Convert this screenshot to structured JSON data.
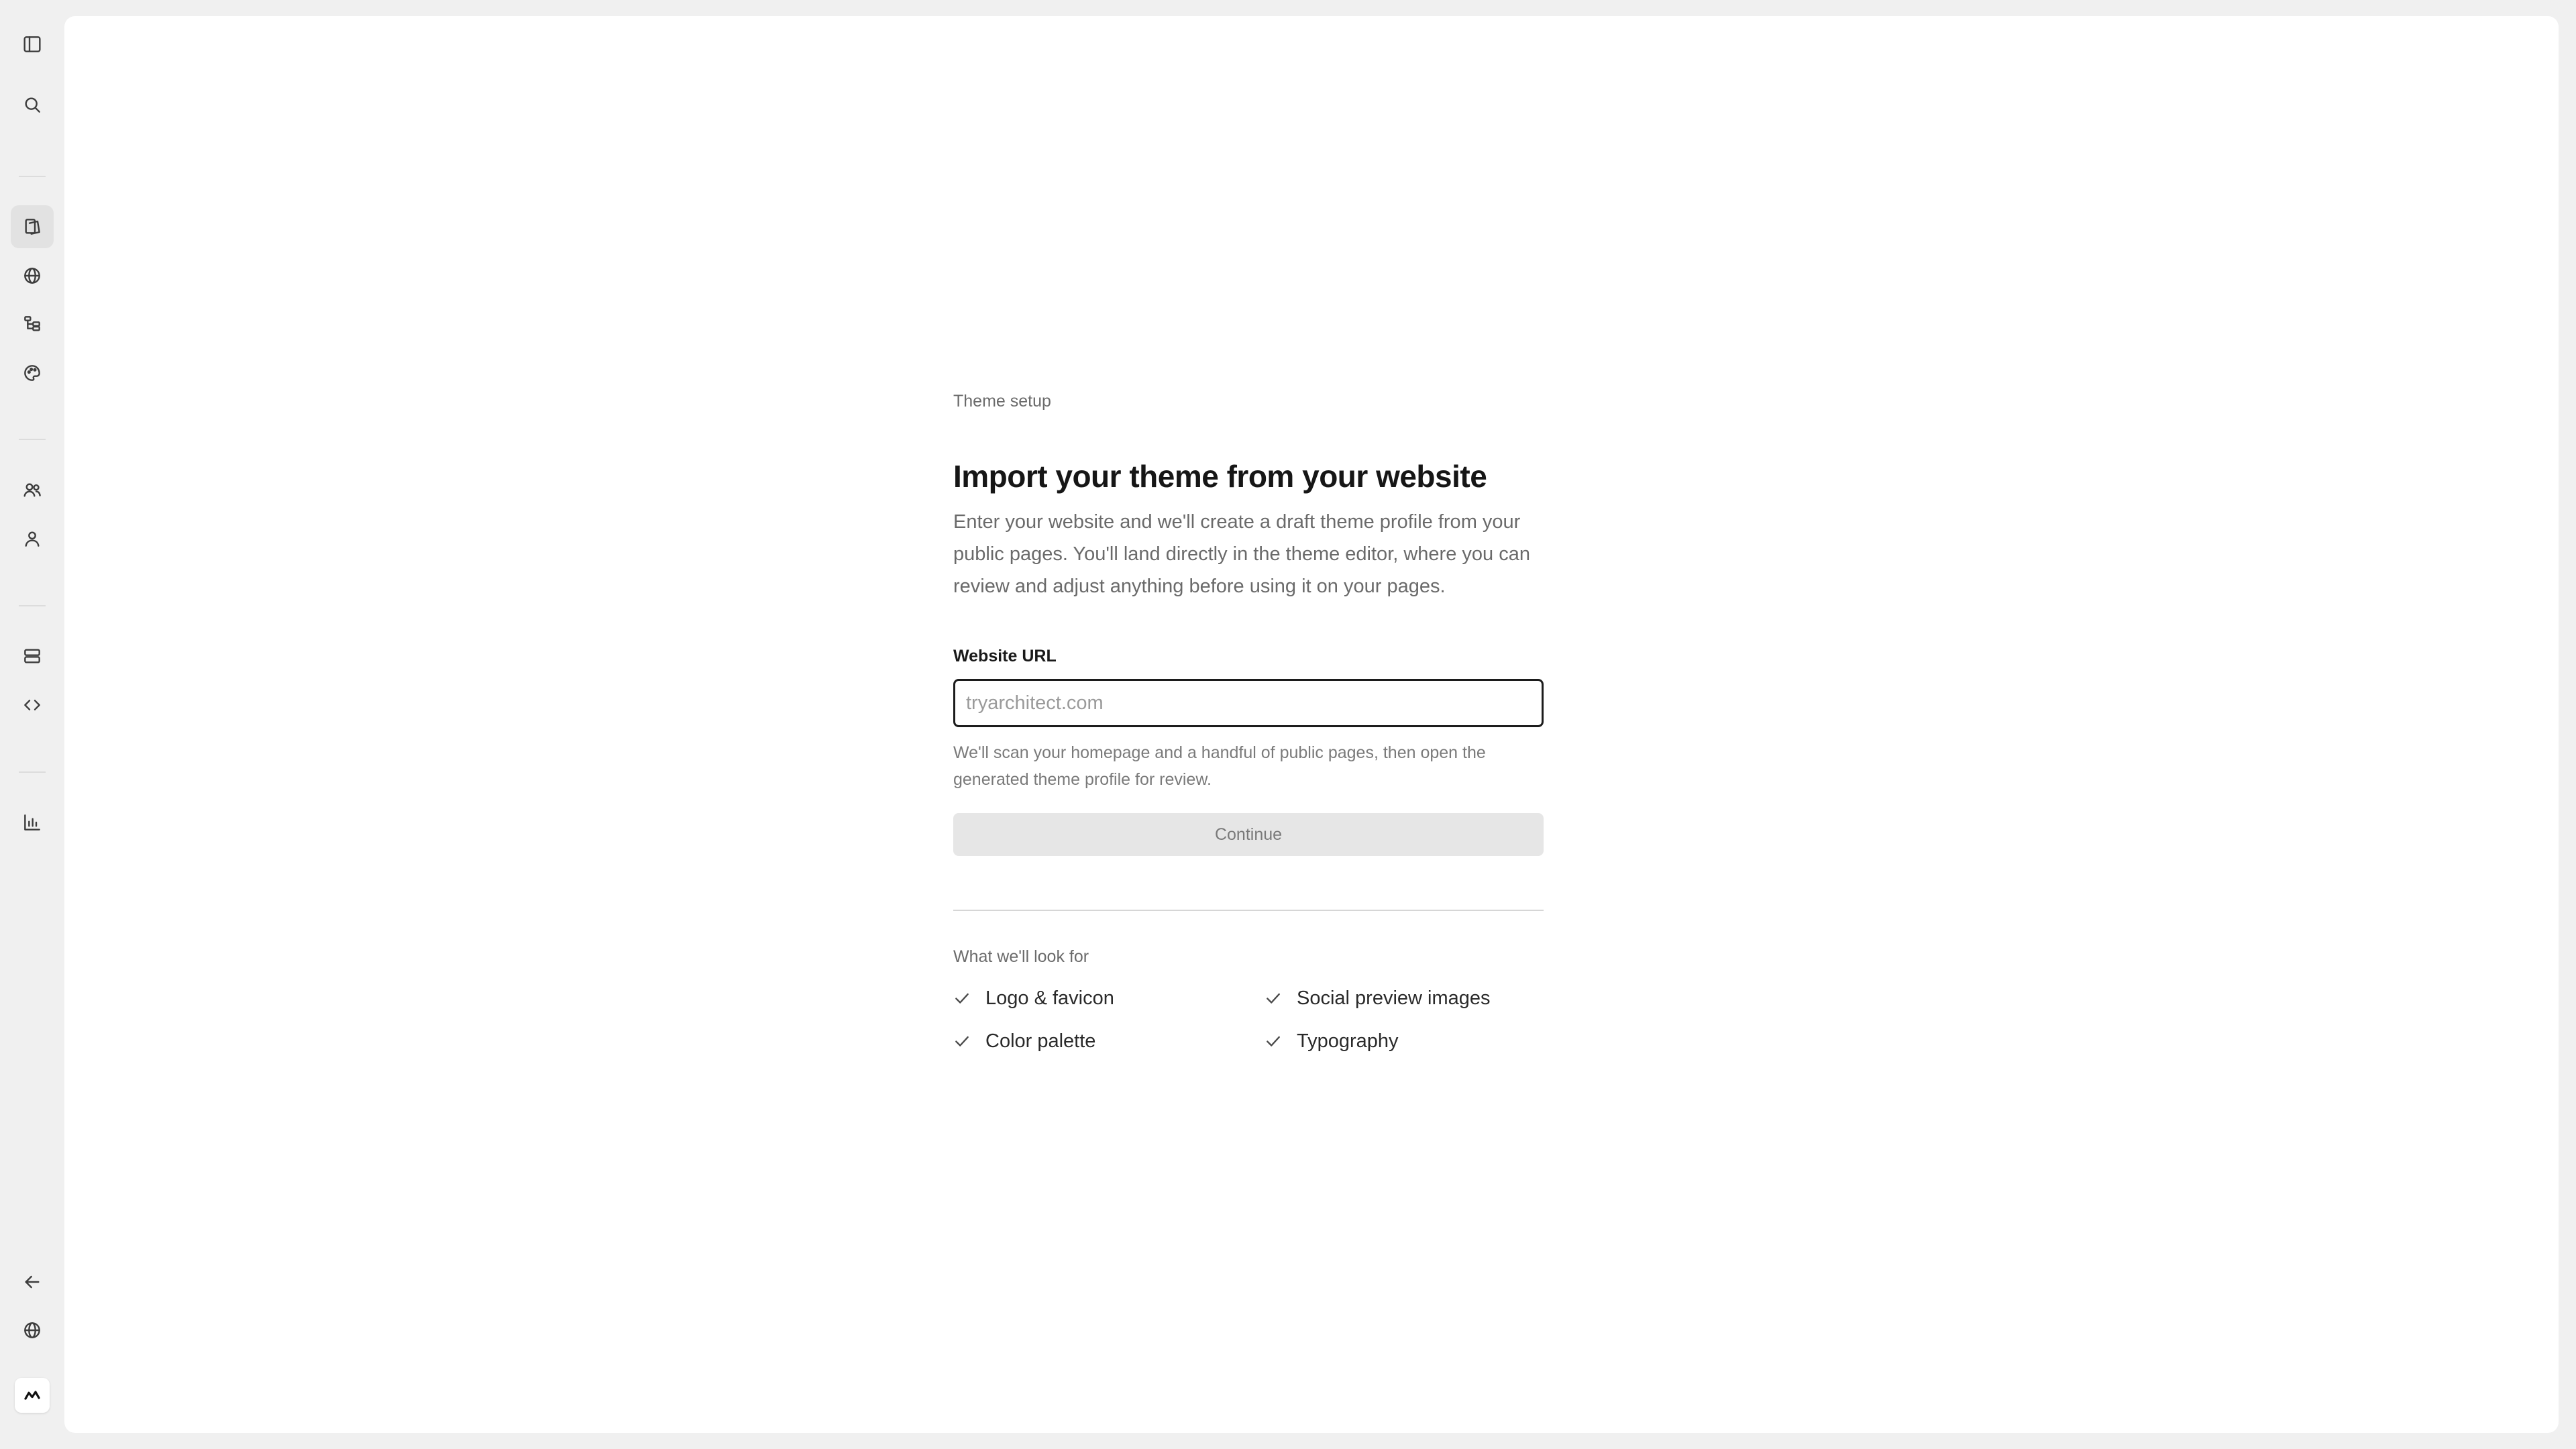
{
  "sidebar": {
    "top_icons": [
      "sidebar-toggle-icon",
      "search-icon"
    ],
    "nav_icons": [
      "pages-icon",
      "globe-icon",
      "sitemap-icon",
      "palette-icon",
      "users-icon",
      "user-icon",
      "database-icon",
      "code-icon",
      "chart-icon"
    ],
    "bottom_icons": [
      "arrow-left-icon",
      "globe-icon",
      "app-logo-icon"
    ]
  },
  "main": {
    "eyebrow": "Theme setup",
    "title": "Import your theme from your website",
    "description": "Enter your website and we'll create a draft theme profile from your public pages. You'll land directly in the theme editor, where you can review and adjust anything before using it on your pages.",
    "url_field": {
      "label": "Website URL",
      "placeholder": "tryarchitect.com",
      "value": ""
    },
    "hint": "We'll scan your homepage and a handful of public pages, then open the generated theme profile for review.",
    "continue_label": "Continue",
    "look_for_title": "What we'll look for",
    "look_for_items": [
      "Logo & favicon",
      "Social preview images",
      "Color palette",
      "Typography"
    ]
  }
}
